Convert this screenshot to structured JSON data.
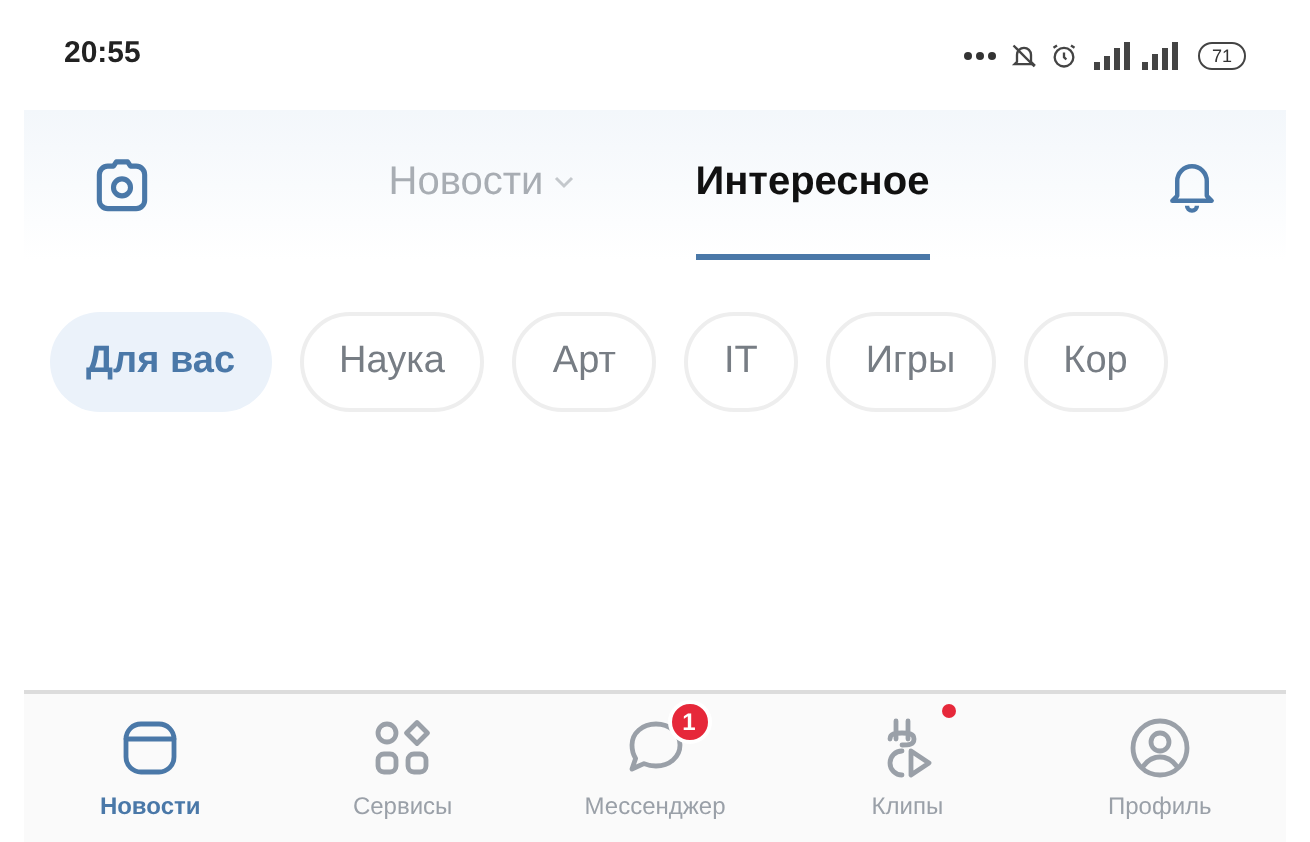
{
  "status_bar": {
    "time": "20:55",
    "battery": "71"
  },
  "header": {
    "tabs": [
      {
        "label": "Новости",
        "selected": false,
        "dropdown": true
      },
      {
        "label": "Интересное",
        "selected": true,
        "dropdown": false
      }
    ]
  },
  "chips": [
    {
      "label": "Для вас",
      "selected": true
    },
    {
      "label": "Наука",
      "selected": false
    },
    {
      "label": "Арт",
      "selected": false
    },
    {
      "label": "IT",
      "selected": false
    },
    {
      "label": "Игры",
      "selected": false
    },
    {
      "label": "Кор",
      "selected": false
    }
  ],
  "bottom_nav": [
    {
      "kind": "news",
      "label": "Новости",
      "selected": true
    },
    {
      "kind": "services",
      "label": "Сервисы",
      "selected": false
    },
    {
      "kind": "messenger",
      "label": "Мессенджер",
      "selected": false,
      "badge": "1"
    },
    {
      "kind": "clips",
      "label": "Клипы",
      "selected": false,
      "dot": true
    },
    {
      "kind": "profile",
      "label": "Профиль",
      "selected": false
    }
  ]
}
